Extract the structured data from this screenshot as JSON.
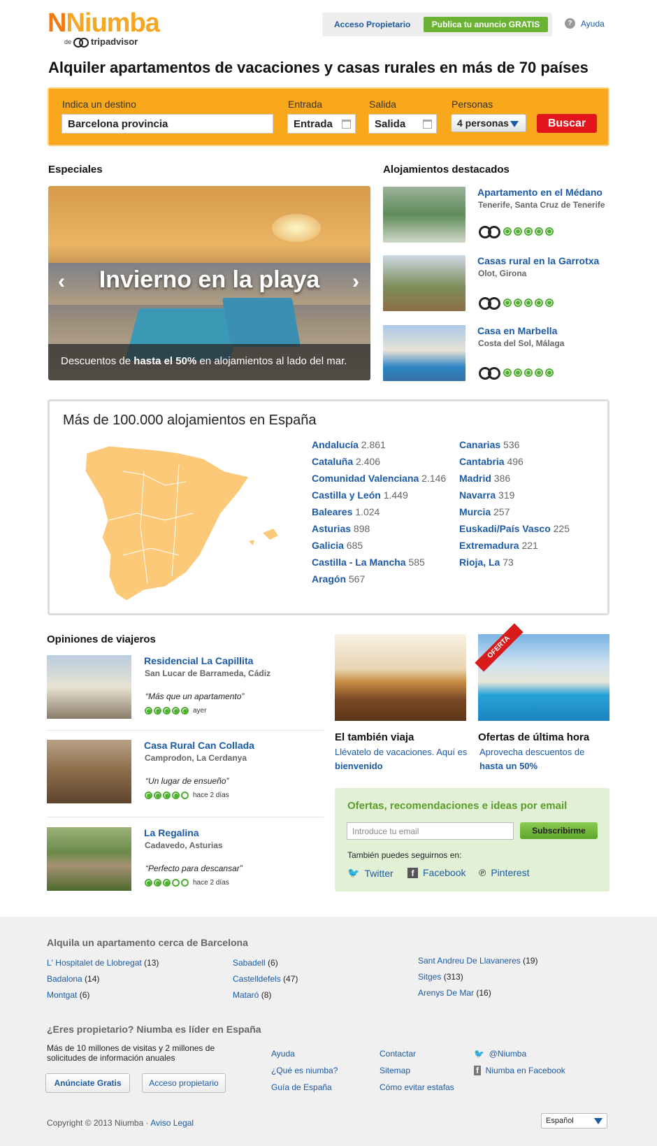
{
  "header": {
    "logo_brand": "Niumba",
    "logo_sub_de": "de",
    "logo_sub_partner": "tripadvisor",
    "owner_access": "Acceso Propietario",
    "publish": "Publica tu anuncio GRATIS",
    "help": "Ayuda",
    "help_icon_glyph": "?"
  },
  "headline": "Alquiler apartamentos de vacaciones y casas rurales en más de 70 países",
  "search": {
    "destination_label": "Indica un destino",
    "destination_value": "Barcelona provincia",
    "checkin_label": "Entrada",
    "checkin_value": "Entrada",
    "checkout_label": "Salida",
    "checkout_value": "Salida",
    "persons_label": "Personas",
    "persons_value": "4 personas",
    "button": "Buscar"
  },
  "specials": {
    "title": "Especiales",
    "slide_title": "Invierno en la playa",
    "caption_pre": "Descuentos de ",
    "caption_bold": "hasta el 50%",
    "caption_post": " en alojamientos al lado del mar.",
    "prev": "‹",
    "next": "›"
  },
  "featured": {
    "title": "Alojamientos destacados",
    "items": [
      {
        "name": "Apartamento en el Médano",
        "location": "Tenerife, Santa Cruz de Tenerife",
        "rating": 5
      },
      {
        "name": "Casas rural en la Garrotxa",
        "location": "Olot, Girona",
        "rating": 5
      },
      {
        "name": "Casa en Marbella",
        "location": "Costa del Sol, Málaga",
        "rating": 5
      }
    ]
  },
  "spain": {
    "title": "Más de 100.000 alojamientos en España",
    "col1": [
      {
        "name": "Andalucía",
        "count": "2.861"
      },
      {
        "name": "Cataluña",
        "count": "2.406"
      },
      {
        "name": "Comunidad Valenciana",
        "count": "2.146"
      },
      {
        "name": "Castilla y León",
        "count": "1.449"
      },
      {
        "name": "Baleares",
        "count": "1.024"
      },
      {
        "name": "Asturias",
        "count": "898"
      },
      {
        "name": "Galicia",
        "count": "685"
      },
      {
        "name": "Castilla - La Mancha",
        "count": "585"
      },
      {
        "name": "Aragón",
        "count": "567"
      }
    ],
    "col2": [
      {
        "name": "Canarias",
        "count": "536"
      },
      {
        "name": "Cantabria",
        "count": "496"
      },
      {
        "name": "Madrid",
        "count": "386"
      },
      {
        "name": "Navarra",
        "count": "319"
      },
      {
        "name": "Murcia",
        "count": "257"
      },
      {
        "name": "Euskadi/País Vasco",
        "count": "225"
      },
      {
        "name": "Extremadura",
        "count": "221"
      },
      {
        "name": "Rioja, La",
        "count": "73"
      }
    ]
  },
  "opinions": {
    "title": "Opiniones de viajeros",
    "items": [
      {
        "name": "Residencial La Capillita",
        "location": "San Lucar de Barrameda, Cádiz",
        "quote": "“Más que un apartamento”",
        "rating": 5,
        "when": "ayer"
      },
      {
        "name": "Casa Rural Can Collada",
        "location": "Camprodon, La Cerdanya",
        "quote": "“Un lugar de ensueño”",
        "rating": 4,
        "when": "hace 2 días"
      },
      {
        "name": "La Regalina",
        "location": "Cadavedo, Asturias",
        "quote": "“Perfecto para descansar”",
        "rating": 3,
        "when": "hace 2 días"
      }
    ]
  },
  "promos": {
    "p1_title": "El también viaja",
    "p1_text": "Llévatelo de vacaciones. Aquí es ",
    "p1_bold": "bienvenido",
    "p2_ribbon": "OFERTA",
    "p2_title": "Ofertas de última hora",
    "p2_text": "Aprovecha descuentos de ",
    "p2_bold": "hasta un 50%"
  },
  "newsletter": {
    "title": "Ofertas, recomendaciones e ideas por email",
    "placeholder": "Introduce tu email",
    "button": "Subscribirme",
    "follow": "También puedes seguirnos en:",
    "twitter": "Twitter",
    "facebook": "Facebook",
    "pinterest": "Pinterest"
  },
  "footer": {
    "near_title": "Alquila un apartamento cerca de Barcelona",
    "near": [
      {
        "name": "L' Hospitalet de Llobregat",
        "count": "(13)"
      },
      {
        "name": "Badalona",
        "count": "(14)"
      },
      {
        "name": "Montgat",
        "count": "(6)"
      },
      {
        "name": "Sabadell",
        "count": "(6)"
      },
      {
        "name": "Castelldefels",
        "count": "(47)"
      },
      {
        "name": "Mataró",
        "count": "(8)"
      },
      {
        "name": "Sant Andreu De Llavaneres",
        "count": "(19)"
      },
      {
        "name": "Sitges",
        "count": "(313)"
      },
      {
        "name": "Arenys De Mar",
        "count": "(16)"
      }
    ],
    "owner_title": "¿Eres propietario? Niumba es líder en España",
    "owner_text": "Más de 10 millones de visitas y 2 millones de solicitudes de información anuales",
    "advertise": "Anúnciate Gratis",
    "owner_access": "Acceso propietario",
    "links1": [
      "Ayuda",
      "¿Qué es niumba?",
      "Guía de España"
    ],
    "links2": [
      "Contactar",
      "Sitemap",
      "Cómo evitar estafas"
    ],
    "twitter": "@Niumba",
    "facebook": "Niumba en Facebook",
    "copyright": "Copyright © 2013 Niumba · ",
    "legal": "Aviso Legal",
    "language": "Español"
  }
}
